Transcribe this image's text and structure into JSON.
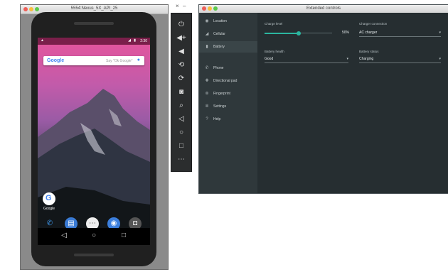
{
  "emulator": {
    "window_title": "5554:Nexus_5X_API_25",
    "status_time": "2:30",
    "search_brand": "Google",
    "search_placeholder": "Say \"Ok Google\"",
    "google_app_label": "Google"
  },
  "toolbar": {
    "buttons": [
      "power-icon",
      "volume-up-icon",
      "volume-down-icon",
      "rotate-left-icon",
      "rotate-right-icon",
      "camera-icon",
      "zoom-icon",
      "back-icon",
      "home-icon",
      "overview-icon",
      "more-icon"
    ]
  },
  "extended_controls": {
    "window_title": "Extended controls",
    "sidebar": [
      {
        "label": "Location"
      },
      {
        "label": "Cellular"
      },
      {
        "label": "Battery"
      },
      {
        "label": "Phone"
      },
      {
        "label": "Directional pad"
      },
      {
        "label": "Fingerprint"
      },
      {
        "label": "Settings"
      },
      {
        "label": "Help"
      }
    ],
    "charge_level_label": "Charge level",
    "charge_level_value": "50%",
    "charge_level": 0.5,
    "charger_connection_label": "Charger connection",
    "charger_connection_value": "AC charger",
    "battery_health_label": "Battery health",
    "battery_health_value": "Good",
    "battery_status_label": "Battery status",
    "battery_status_value": "Charging"
  },
  "colors": {
    "accent": "#2bb6a0",
    "panel_bg": "#262e31",
    "sidebar_bg": "#2f383b"
  }
}
